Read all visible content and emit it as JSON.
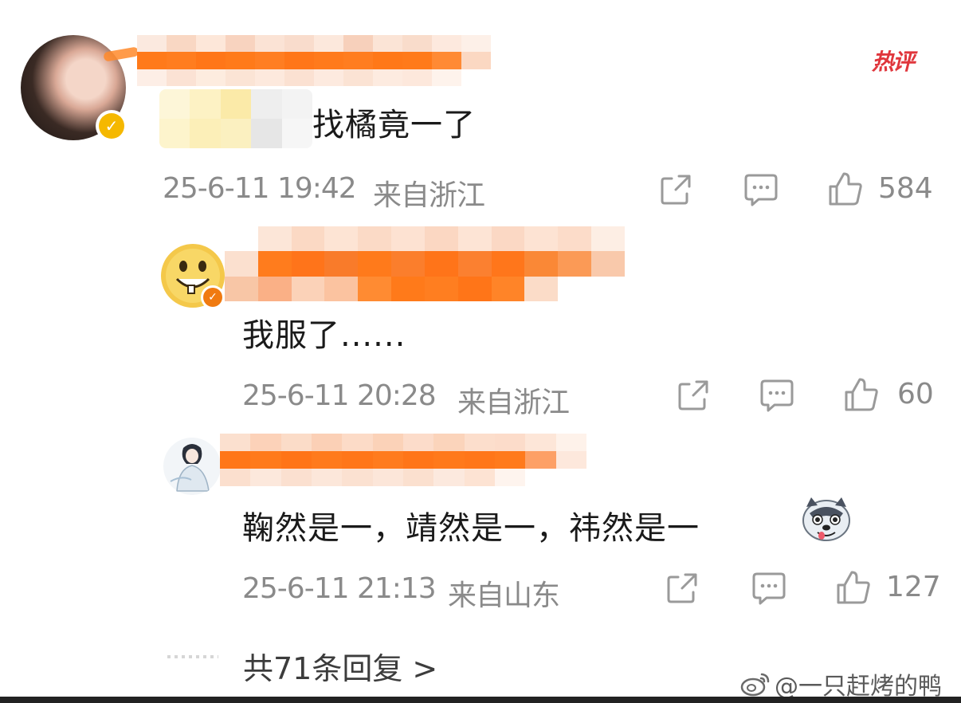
{
  "hot_badge": "热评",
  "comments": [
    {
      "content_visible": "找橘竟一了",
      "time": "25-6-11 19:42",
      "location": "来自浙江",
      "likes": "584"
    },
    {
      "content": "我服了......",
      "time": "25-6-11 20:28",
      "location": "来自浙江",
      "likes": "60"
    },
    {
      "content": "鞠然是一，靖然是一，祎然是一",
      "time": "25-6-11 21:13",
      "location": "来自山东",
      "likes": "127"
    }
  ],
  "replies_link": "共71条回复 >",
  "watermark": "@一只赶烤的鸭",
  "icons": {
    "share": "share-icon",
    "comment": "comment-icon",
    "like": "thumbs-up-icon",
    "verified": "verified-badge-icon",
    "emoji": "husky-emoji-icon",
    "weibo": "weibo-logo-icon"
  },
  "colors": {
    "hot": "#e0363c",
    "verified_gold": "#f5b800",
    "verified_orange": "#f07a10",
    "username_blur": "#ff7a1a",
    "meta_gray": "#8a8a8a"
  }
}
